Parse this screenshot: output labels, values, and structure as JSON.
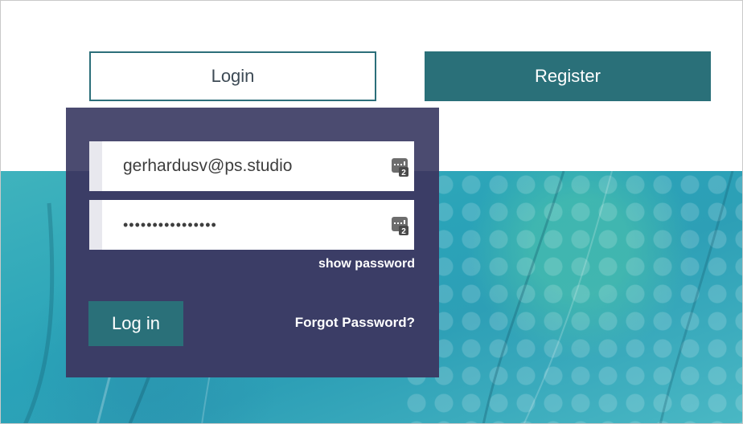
{
  "tabs": {
    "login_label": "Login",
    "register_label": "Register"
  },
  "form": {
    "email_value": "gerhardusv@ps.studio",
    "password_value": "••••••••••••••••",
    "show_password_label": "show password",
    "login_button_label": "Log in",
    "forgot_password_label": "Forgot Password?",
    "password_manager_icon": "password-manager-icon"
  },
  "colors": {
    "accent": "#2a7079",
    "panel": "#3b3d66",
    "panel_top": "#4b4b70",
    "hero": "#2aa3b8"
  }
}
